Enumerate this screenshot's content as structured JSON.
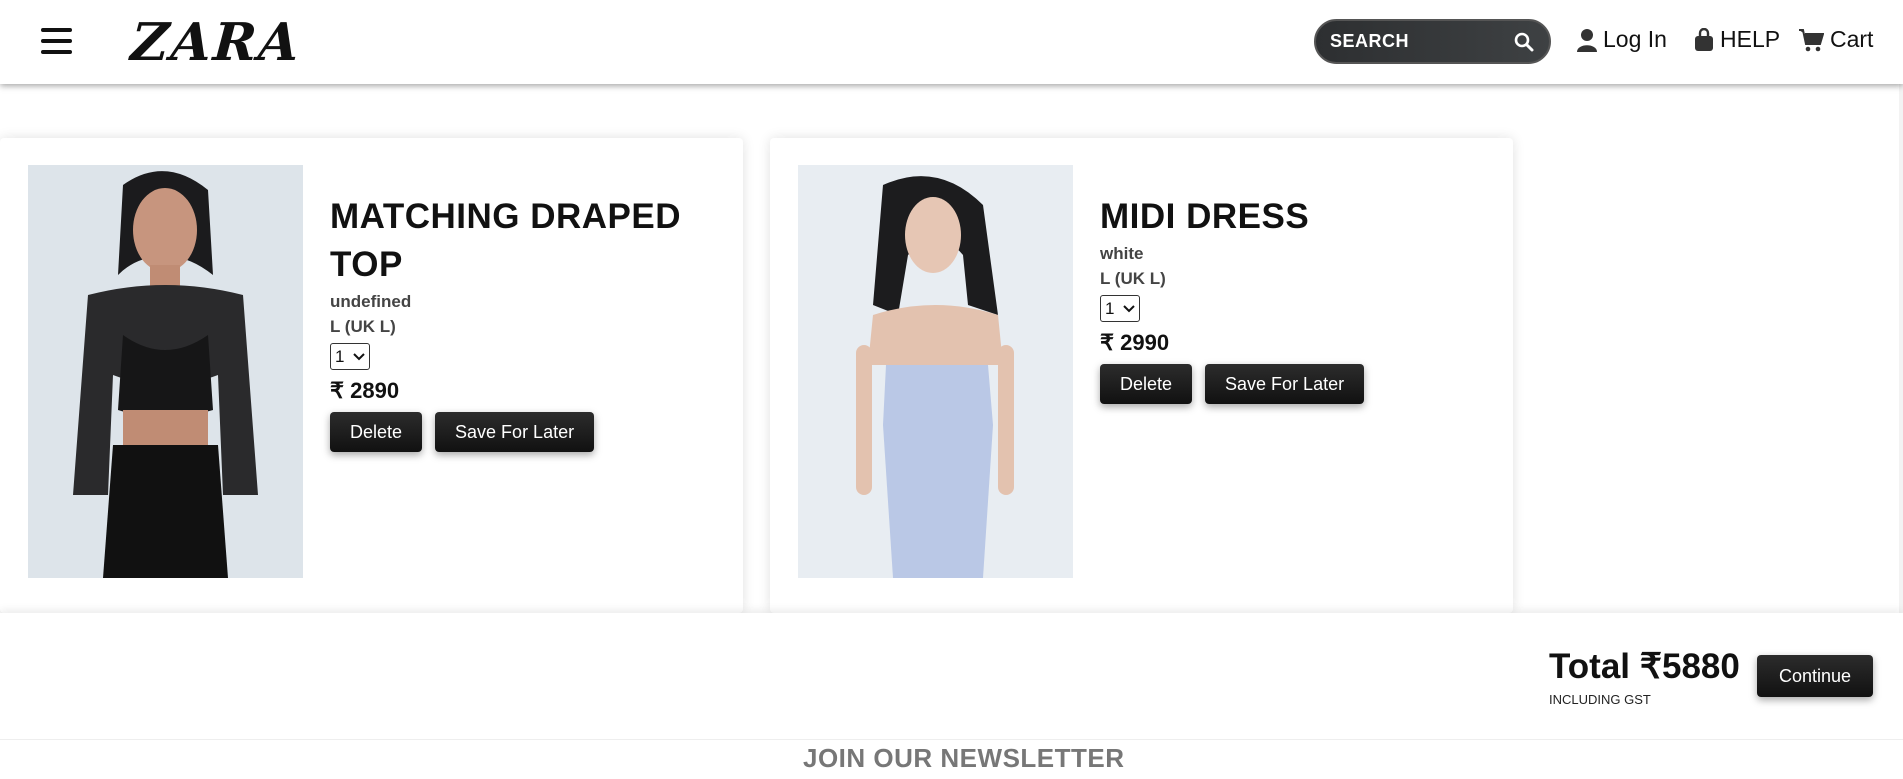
{
  "header": {
    "logo": "ZARA",
    "search_placeholder": "SEARCH",
    "login_label": "Log In",
    "help_label": "HELP",
    "cart_label": "Cart"
  },
  "cart": {
    "items": [
      {
        "title": "MATCHING DRAPED TOP",
        "color": "undefined",
        "size": "L (UK L)",
        "quantity": "1",
        "price": "₹ 2890",
        "delete_label": "Delete",
        "save_label": "Save For Later"
      },
      {
        "title": "MIDI DRESS",
        "color": "white",
        "size": "L (UK L)",
        "quantity": "1",
        "price": "₹ 2990",
        "delete_label": "Delete",
        "save_label": "Save For Later"
      }
    ],
    "total": "Total ₹5880",
    "gst_note": "INCLUDING GST",
    "continue_label": "Continue"
  },
  "footer": {
    "newsletter": "JOIN OUR NEWSLETTER"
  },
  "colors": {
    "button_bg": "#1a1a1a",
    "search_bg": "#333638",
    "newsletter_text": "#777777"
  }
}
